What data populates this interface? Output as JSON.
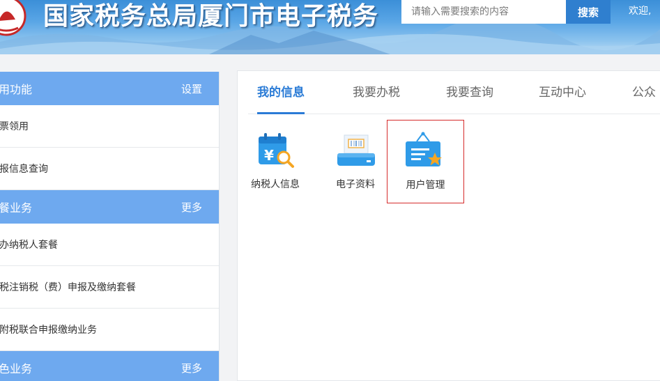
{
  "header": {
    "site_title": "国家税务总局厦门市电子税务",
    "search_placeholder": "请输入需要搜索的内容",
    "search_button": "搜索",
    "welcome_text": "欢迎,",
    "colors": {
      "banner": "#4b9be0",
      "search_button": "#2f7fcf"
    }
  },
  "sidebar": {
    "sections": [
      {
        "title": "用功能",
        "action": "设置",
        "items": [
          "票领用",
          "报信息查询"
        ]
      },
      {
        "title": "餐业务",
        "action": "更多",
        "items": [
          "办纳税人套餐",
          "税注销税（费）申报及缴纳套餐",
          "附税联合申报缴纳业务"
        ]
      },
      {
        "title": "色业务",
        "action": "更多",
        "items": []
      }
    ],
    "colors": {
      "section_header": "#6ea9ef"
    }
  },
  "main": {
    "tabs": [
      {
        "label": "我的信息",
        "active": true
      },
      {
        "label": "我要办税",
        "active": false
      },
      {
        "label": "我要查询",
        "active": false
      },
      {
        "label": "互动中心",
        "active": false
      },
      {
        "label": "公众",
        "active": false
      }
    ],
    "apps": [
      {
        "label": "纳税人信息",
        "icon": "taxpayer-info-icon",
        "selected": false
      },
      {
        "label": "电子资料",
        "icon": "scanner-icon",
        "selected": false
      },
      {
        "label": "用户管理",
        "icon": "user-management-icon",
        "selected": true
      }
    ],
    "colors": {
      "active_tab": "#2a7bd6",
      "selection_border": "#d62b2b"
    }
  }
}
